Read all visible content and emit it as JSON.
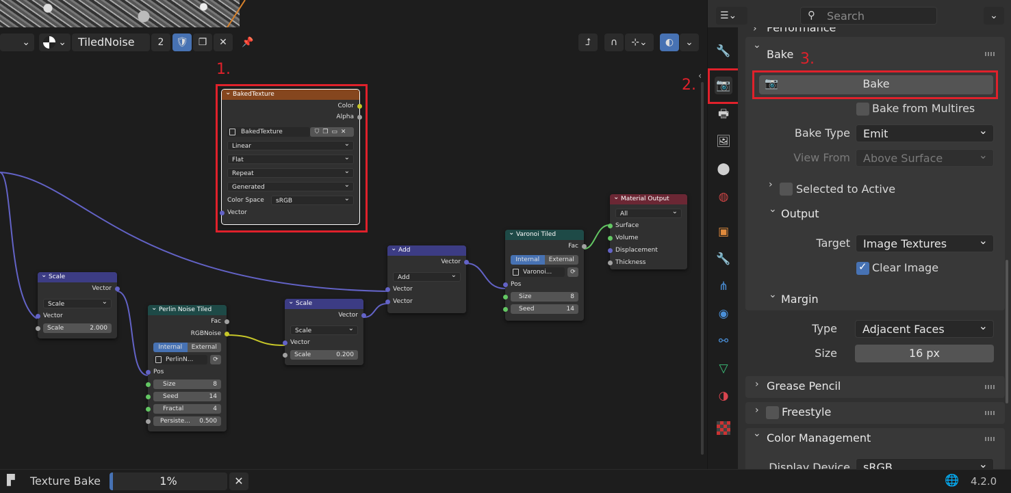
{
  "header": {
    "node_tree_name": "TiledNoise",
    "user_count": "2"
  },
  "annotations": {
    "label1": "1.",
    "label2": "2.",
    "label3": "3."
  },
  "nodes": {
    "baked_texture": {
      "title": "BakedTexture",
      "out_color": "Color",
      "out_alpha": "Alpha",
      "image_name": "BakedTexture",
      "interpolation": "Linear",
      "projection": "Flat",
      "extension": "Repeat",
      "source": "Generated",
      "color_space_label": "Color Space",
      "color_space": "sRGB",
      "in_vector": "Vector"
    },
    "scale1": {
      "title": "Scale",
      "out": "Vector",
      "mode": "Scale",
      "in_vector": "Vector",
      "scale_label": "Scale",
      "scale_value": "2.000"
    },
    "perlin": {
      "title": "Perlin Noise Tiled",
      "out_fac": "Fac",
      "out_rgb": "RGBNoise",
      "tab_internal": "Internal",
      "tab_external": "External",
      "datablock": "PerlinN...",
      "in_pos": "Pos",
      "size_label": "Size",
      "size_value": "8",
      "seed_label": "Seed",
      "seed_value": "14",
      "fractal_label": "Fractal",
      "fractal_value": "4",
      "persist_label": "Persiste...",
      "persist_value": "0.500"
    },
    "scale2": {
      "title": "Scale",
      "out": "Vector",
      "mode": "Scale",
      "in_vector": "Vector",
      "scale_label": "Scale",
      "scale_value": "0.200"
    },
    "add": {
      "title": "Add",
      "out": "Vector",
      "mode": "Add",
      "in1": "Vector",
      "in2": "Vector"
    },
    "voronoi": {
      "title": "Varonoi Tiled",
      "out_fac": "Fac",
      "tab_internal": "Internal",
      "tab_external": "External",
      "datablock": "Varonoi...",
      "in_pos": "Pos",
      "size_label": "Size",
      "size_value": "8",
      "seed_label": "Seed",
      "seed_value": "14"
    },
    "material_output": {
      "title": "Material Output",
      "target": "All",
      "in_surface": "Surface",
      "in_volume": "Volume",
      "in_displacement": "Displacement",
      "in_thickness": "Thickness"
    }
  },
  "properties": {
    "search_placeholder": "Search",
    "performance_label": "Performance",
    "bake_panel": "Bake",
    "bake_button": "Bake",
    "bake_from_multires": "Bake from Multires",
    "bake_type_label": "Bake Type",
    "bake_type_value": "Emit",
    "view_from_label": "View From",
    "view_from_value": "Above Surface",
    "selected_to_active": "Selected to Active",
    "output_label": "Output",
    "target_label": "Target",
    "target_value": "Image Textures",
    "clear_image": "Clear Image",
    "margin_label": "Margin",
    "type_label": "Type",
    "type_value": "Adjacent Faces",
    "size_label": "Size",
    "size_value": "16 px",
    "grease_pencil": "Grease Pencil",
    "freestyle": "Freestyle",
    "color_management": "Color Management",
    "display_device_label": "Display Device",
    "display_device_value": "sRGB"
  },
  "status": {
    "job_label": "Texture Bake",
    "progress_text": "1%",
    "progress": 0.01,
    "version": "4.2.0"
  }
}
